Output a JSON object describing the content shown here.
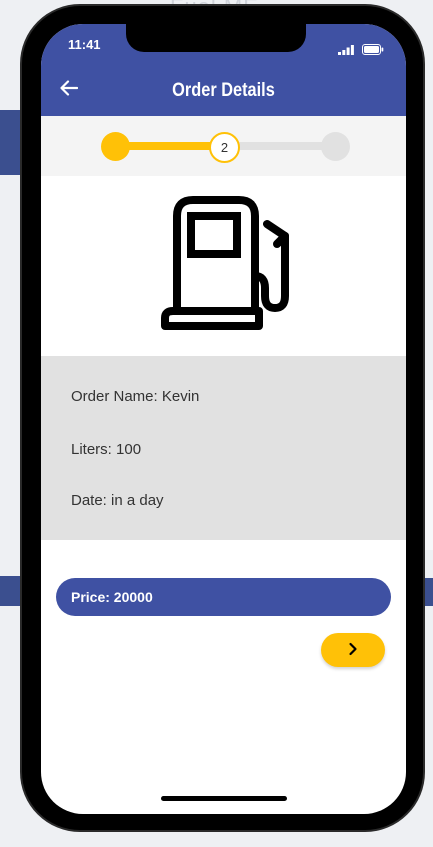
{
  "background": {
    "title": "Fuel ME"
  },
  "status_bar": {
    "time": "11:41",
    "signal_icon": "cellular-signal-icon",
    "battery_icon": "battery-icon"
  },
  "app_bar": {
    "title": "Order Details",
    "back_icon": "arrow-left-icon"
  },
  "stepper": {
    "current_step": "2",
    "total_steps": 3
  },
  "main": {
    "icon": "fuel-pump-icon"
  },
  "details": {
    "order_name": "Order Name: Kevin",
    "liters": "Liters: 100",
    "date": "Date: in a day"
  },
  "price": {
    "label": "Price: 20000"
  },
  "next_button": {
    "icon": "chevron-right-icon"
  },
  "colors": {
    "primary": "#3f51a3",
    "accent": "#ffc107",
    "panel": "#e1e1e1"
  }
}
